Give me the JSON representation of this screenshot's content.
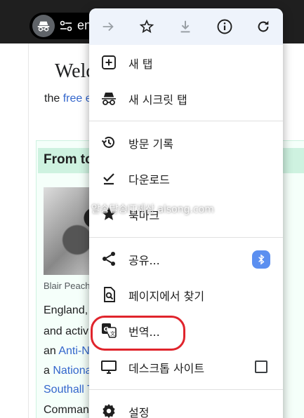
{
  "browser": {
    "url_text": "en"
  },
  "page": {
    "welcome": "Welc",
    "tagline_prefix": "the ",
    "tagline_link": "free e",
    "today_heading": "From to",
    "photo_caption": "Blair Peach",
    "lines": [
      {
        "text": "England, F",
        "link": ""
      },
      {
        "text": "and activis",
        "link": ""
      },
      {
        "text": "an ",
        "link": "Anti-Na"
      },
      {
        "text": "a ",
        "link": "National"
      },
      {
        "text": "",
        "link": "Southall T"
      },
      {
        "text": "Command",
        "link": ""
      }
    ]
  },
  "menu": {
    "toolbar": [
      {
        "name": "forward-button",
        "icon": "arrow-forward-icon"
      },
      {
        "name": "bookmark-star-button",
        "icon": "star-outline-icon"
      },
      {
        "name": "download-page-button",
        "icon": "download-icon"
      },
      {
        "name": "page-info-button",
        "icon": "info-icon"
      },
      {
        "name": "reload-button",
        "icon": "refresh-icon"
      }
    ],
    "items": [
      {
        "label": "새 탭",
        "icon": "add-box-icon"
      },
      {
        "label": "새 시크릿 탭",
        "icon": "incognito-icon"
      },
      {
        "label": "방문 기록",
        "icon": "history-icon"
      },
      {
        "label": "다운로드",
        "icon": "download-done-icon"
      },
      {
        "label": "북마크",
        "icon": "star-filled-icon"
      },
      {
        "label": "공유...",
        "icon": "share-icon"
      },
      {
        "label": "페이지에서 찾기",
        "icon": "find-in-page-icon"
      },
      {
        "label": "번역...",
        "icon": "translate-icon"
      },
      {
        "label": "데스크톱 사이트",
        "icon": "desktop-icon"
      },
      {
        "label": "설정",
        "icon": "settings-gear-icon"
      }
    ],
    "share_badge_icon": "bluetooth-icon",
    "desktop_site_checked": false
  },
  "watermark": "알송달송IT세상 alsong.com",
  "colors": {
    "highlight": "#e0242c",
    "menu_toolbar_bg": "#eef3fb",
    "link": "#3366cc",
    "bluetooth_badge": "#5b8ff0"
  }
}
